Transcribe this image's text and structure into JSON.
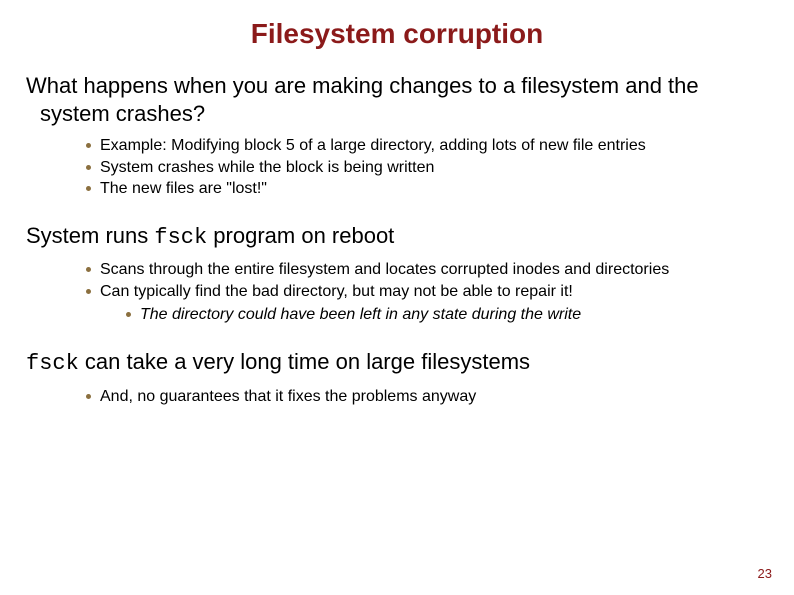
{
  "slide": {
    "title": "Filesystem corruption",
    "page_number": "23",
    "sections": [
      {
        "text_a": "What happens when you are making changes to a filesystem and the",
        "text_b": "system crashes?",
        "bullets": [
          "Example: Modifying block 5 of a large directory, adding lots of new file entries",
          "System crashes while the block is being written",
          "The new files are \"lost!\""
        ]
      },
      {
        "text_a": "System runs ",
        "code": "fsck",
        "text_b": " program on reboot",
        "bullets": [
          "Scans through the entire filesystem and locates corrupted inodes and directories",
          "Can typically find the bad directory, but may not be able to repair it!"
        ],
        "nested": [
          "The directory could have been left in any state during the write"
        ]
      },
      {
        "code": "fsck",
        "text_a": " can take a very long time on large filesystems",
        "bullets": [
          "And, no guarantees that it fixes the problems anyway"
        ]
      }
    ]
  }
}
